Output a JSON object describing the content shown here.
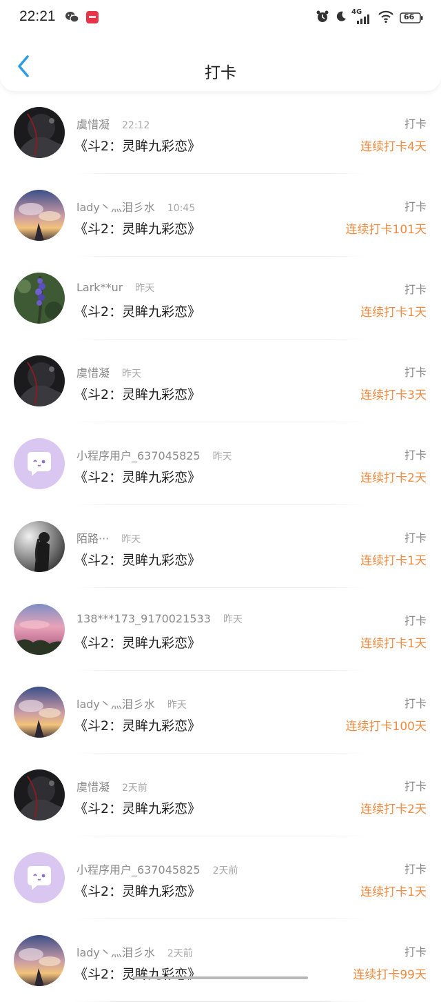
{
  "status_bar": {
    "time": "22:21",
    "network": "4G",
    "battery": "66"
  },
  "header": {
    "title": "打卡"
  },
  "colors": {
    "accent": "#f08a40",
    "back": "#2a9de6"
  },
  "entries": [
    {
      "user": "虞惜凝",
      "time": "22:12",
      "book": "《斗2：灵眸九彩恋》",
      "action": "打卡",
      "streak": "连续打卡4天",
      "avatar": "dark-anime-avatar"
    },
    {
      "user": "lady丶灬泪彡水",
      "time": "10:45",
      "book": "《斗2：灵眸九彩恋》",
      "action": "打卡",
      "streak": "连续打卡101天",
      "avatar": "sunset-anime-avatar"
    },
    {
      "user": "Lark**ur",
      "time": "昨天",
      "book": "《斗2：灵眸九彩恋》",
      "action": "打卡",
      "streak": "连续打卡1天",
      "avatar": "lavender-flower-avatar"
    },
    {
      "user": "虞惜凝",
      "time": "昨天",
      "book": "《斗2：灵眸九彩恋》",
      "action": "打卡",
      "streak": "连续打卡3天",
      "avatar": "dark-anime-avatar"
    },
    {
      "user": "小程序用户_637045825",
      "time": "昨天",
      "book": "《斗2：灵眸九彩恋》",
      "action": "打卡",
      "streak": "连续打卡2天",
      "avatar": "default-chat-avatar"
    },
    {
      "user": "陌路···",
      "time": "昨天",
      "book": "《斗2：灵眸九彩恋》",
      "action": "打卡",
      "streak": "连续打卡1天",
      "avatar": "monochrome-girl-avatar"
    },
    {
      "user": "138***173_9170021533",
      "time": "昨天",
      "book": "《斗2：灵眸九彩恋》",
      "action": "打卡",
      "streak": "连续打卡1天",
      "avatar": "pink-sky-avatar"
    },
    {
      "user": "lady丶灬泪彡水",
      "time": "昨天",
      "book": "《斗2：灵眸九彩恋》",
      "action": "打卡",
      "streak": "连续打卡100天",
      "avatar": "sunset-anime-avatar"
    },
    {
      "user": "虞惜凝",
      "time": "2天前",
      "book": "《斗2：灵眸九彩恋》",
      "action": "打卡",
      "streak": "连续打卡2天",
      "avatar": "dark-anime-avatar"
    },
    {
      "user": "小程序用户_637045825",
      "time": "2天前",
      "book": "《斗2：灵眸九彩恋》",
      "action": "打卡",
      "streak": "连续打卡1天",
      "avatar": "default-chat-avatar"
    },
    {
      "user": "lady丶灬泪彡水",
      "time": "2天前",
      "book": "《斗2：灵眸九彩恋》",
      "action": "打卡",
      "streak": "连续打卡99天",
      "avatar": "sunset-anime-avatar"
    }
  ]
}
